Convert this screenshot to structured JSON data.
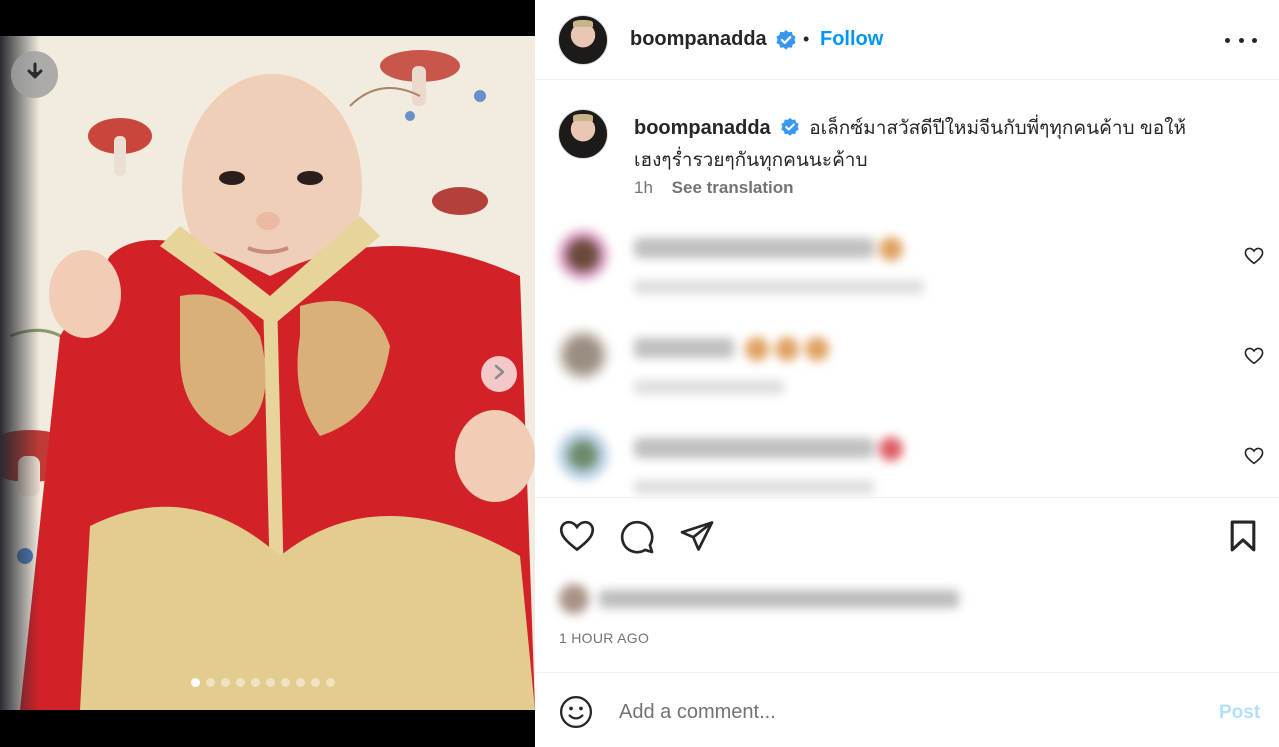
{
  "post": {
    "username": "boompanadda",
    "follow_label": "Follow",
    "separator": "•",
    "caption_line1": "อเล็กซ์มาสวัสดีปีใหม่จีนกับพี่ๆทุกคนค้าบ ขอให้",
    "caption_line2": "เฮงๆร่ำรวยๆกันทุกคนนะค้าบ",
    "caption_age": "1h",
    "see_translation": "See translation",
    "timestamp": "1 HOUR AGO",
    "comment_placeholder": "Add a comment...",
    "post_label": "Post"
  },
  "media": {
    "slide_count": 10,
    "current_slide": 1
  },
  "icons": {
    "download": "download-icon",
    "next": "chevron-right-icon",
    "verified": "verified-badge-icon",
    "more": "more-options-icon",
    "like": "heart-icon",
    "comment": "comment-icon",
    "share": "share-icon",
    "save": "bookmark-icon",
    "emoji": "emoji-icon"
  },
  "colors": {
    "accent": "#0095f6",
    "post_disabled": "#b2dffc",
    "muted_text": "#737373",
    "verified": "#3897f0"
  }
}
